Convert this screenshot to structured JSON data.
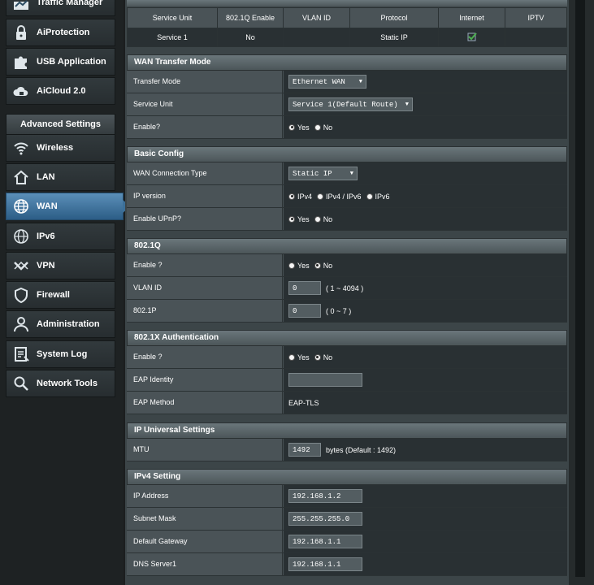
{
  "sidebar": {
    "top_items": [
      {
        "label": "Traffic Manager"
      },
      {
        "label": "AiProtection"
      },
      {
        "label": "USB Application"
      },
      {
        "label": "AiCloud 2.0"
      }
    ],
    "advanced_header": "Advanced Settings",
    "items": [
      {
        "label": "Wireless"
      },
      {
        "label": "LAN"
      },
      {
        "label": "WAN"
      },
      {
        "label": "IPv6"
      },
      {
        "label": "VPN"
      },
      {
        "label": "Firewall"
      },
      {
        "label": "Administration"
      },
      {
        "label": "System Log"
      },
      {
        "label": "Network Tools"
      }
    ],
    "active_item": "WAN"
  },
  "summary": {
    "headers": [
      "Service Unit",
      "802.1Q Enable",
      "VLAN ID",
      "Protocol",
      "Internet",
      "IPTV"
    ],
    "row": {
      "service_unit": "Service 1",
      "enable_8021q": "No",
      "vlan_id": "",
      "protocol": "Static IP",
      "internet_icon": "check-icon",
      "iptv": ""
    }
  },
  "wan_transfer": {
    "title": "WAN Transfer Mode",
    "transfer_mode_label": "Transfer Mode",
    "transfer_mode_value": "Ethernet WAN",
    "service_unit_label": "Service Unit",
    "service_unit_value": "Service 1(Default Route)",
    "enable_label": "Enable?",
    "yes": "Yes",
    "no": "No"
  },
  "basic_config": {
    "title": "Basic Config",
    "conn_type_label": "WAN Connection Type",
    "conn_type_value": "Static IP",
    "ip_version_label": "IP version",
    "ipv4": "IPv4",
    "ipv4_ipv6": "IPv4 / IPv6",
    "ipv6": "IPv6",
    "upnp_label": "Enable UPnP?",
    "yes": "Yes",
    "no": "No"
  },
  "dot1q": {
    "title": "802.1Q",
    "enable_label": "Enable ?",
    "yes": "Yes",
    "no": "No",
    "vlan_label": "VLAN ID",
    "vlan_value": "0",
    "vlan_hint": "( 1 ~ 4094 )",
    "p_label": "802.1P",
    "p_value": "0",
    "p_hint": "( 0 ~ 7 )"
  },
  "dot1x": {
    "title": "802.1X Authentication",
    "enable_label": "Enable ?",
    "yes": "Yes",
    "no": "No",
    "eap_identity_label": "EAP Identity",
    "eap_identity_value": "",
    "eap_method_label": "EAP Method",
    "eap_method_value": "EAP-TLS"
  },
  "ip_universal": {
    "title": "IP Universal Settings",
    "mtu_label": "MTU",
    "mtu_value": "1492",
    "mtu_hint": "bytes (Default : 1492)"
  },
  "ipv4": {
    "title": "IPv4 Setting",
    "ip_label": "IP Address",
    "ip_value": "192.168.1.2",
    "mask_label": "Subnet Mask",
    "mask_value": "255.255.255.0",
    "gw_label": "Default Gateway",
    "gw_value": "192.168.1.1",
    "dns1_label": "DNS Server1",
    "dns1_value": "192.168.1.1"
  },
  "colors": {
    "active_blue": "#3c7099",
    "panel_bg": "#3c4548",
    "value_bg": "#293033",
    "check_green": "#4caf50"
  }
}
